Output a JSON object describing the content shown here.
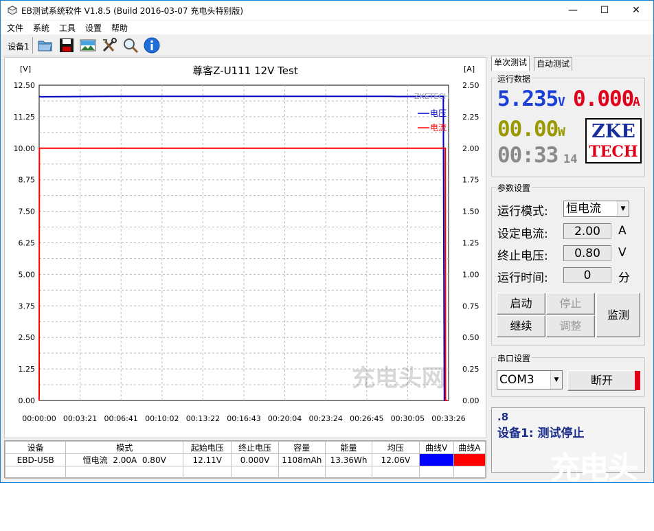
{
  "window": {
    "title": "EB测试系统软件 V1.8.5 (Build 2016-03-07 充电头特别版)",
    "minimize": "—",
    "maximize": "☐",
    "close": "✕"
  },
  "menu": [
    "文件",
    "系统",
    "工具",
    "设置",
    "帮助"
  ],
  "toolbar": {
    "device_label": "设备1",
    "icons": [
      "open-folder-icon",
      "save-icon",
      "picture-icon",
      "tools-icon",
      "search-icon",
      "info-icon"
    ]
  },
  "chart_data": {
    "type": "line",
    "title": "尊客Z-U111 12V Test",
    "left_unit": "[V]",
    "right_unit": "[A]",
    "brand_label": "ZKETECH",
    "left_ticks": [
      "12.50",
      "11.25",
      "10.00",
      "8.75",
      "7.50",
      "6.25",
      "5.00",
      "3.75",
      "2.50",
      "1.25",
      "0.00"
    ],
    "right_ticks": [
      "2.50",
      "2.25",
      "2.00",
      "1.75",
      "1.50",
      "1.25",
      "1.00",
      "0.75",
      "0.50",
      "0.25",
      "0.00"
    ],
    "x_ticks": [
      "00:00:00",
      "00:03:21",
      "00:06:41",
      "00:10:02",
      "00:13:22",
      "00:16:43",
      "00:20:04",
      "00:23:24",
      "00:26:45",
      "00:30:05",
      "00:33:26"
    ],
    "ylim_left": [
      0,
      12.5
    ],
    "ylim_right": [
      0,
      2.5
    ],
    "series": [
      {
        "name": "电压",
        "color": "#0000c0",
        "axis": "left",
        "x_sec": [
          0,
          10,
          360,
          1720,
          1760,
          1980,
          1985,
          2000
        ],
        "values": [
          12.05,
          12.04,
          12.06,
          12.06,
          12.05,
          12.06,
          0.0,
          0.0
        ]
      },
      {
        "name": "电流",
        "color": "#ff0000",
        "axis": "right",
        "x_sec": [
          0,
          1,
          1990,
          1991,
          2000
        ],
        "values": [
          0.0,
          2.0,
          2.0,
          0.0,
          0.0
        ]
      }
    ]
  },
  "tabs": [
    "单次测试",
    "自动测试"
  ],
  "run_data": {
    "title": "运行数据",
    "voltage": "5.235",
    "voltage_unit": "V",
    "current": "0.000",
    "current_unit": "A",
    "power": "00.00",
    "power_unit": "W",
    "time": "00:33",
    "time_sec": "14",
    "logo_line1": "ZKE",
    "logo_line2": "TECH"
  },
  "params": {
    "title": "参数设置",
    "mode_label": "运行模式:",
    "mode_value": "恒电流",
    "current_label": "设定电流:",
    "current_value": "2.00",
    "current_unit": "A",
    "cutoff_label": "终止电压:",
    "cutoff_value": "0.80",
    "cutoff_unit": "V",
    "time_label": "运行时间:",
    "time_value": "0",
    "time_unit": "分"
  },
  "buttons": {
    "start": "启动",
    "stop": "停止",
    "resume": "继续",
    "adjust": "调整",
    "monitor": "监测"
  },
  "serial": {
    "title": "串口设置",
    "port": "COM3",
    "disconnect": "断开"
  },
  "status": {
    "line1": ".8",
    "line2": "设备1: 测试停止"
  },
  "table": {
    "headers": [
      "设备",
      "模式",
      "起始电压",
      "终止电压",
      "容量",
      "能量",
      "均压",
      "曲线V",
      "曲线A"
    ],
    "row": [
      "EBD-USB",
      "恒电流  2.00A  0.80V",
      "12.11V",
      "0.000V",
      "1108mAh",
      "13.36Wh",
      "12.06V",
      "",
      ""
    ],
    "curve_v_color": "#0000ff",
    "curve_a_color": "#ff0000"
  },
  "watermark": "充电头网"
}
